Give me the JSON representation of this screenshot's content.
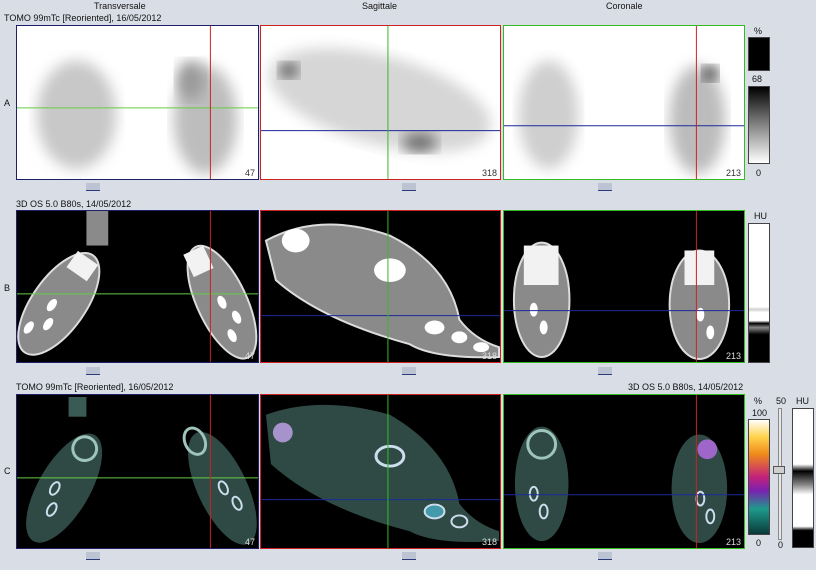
{
  "columns": {
    "transversale": "Transversale",
    "sagittale": "Sagittale",
    "coronale": "Coronale"
  },
  "rows": {
    "a": {
      "label": "A",
      "series": "TOMO 99mTc [Reoriented], 16/05/2012"
    },
    "b": {
      "label": "B",
      "series": "3D  OS  5.0  B80s, 14/05/2012"
    },
    "c": {
      "label": "C",
      "series_left": "TOMO 99mTc [Reoriented], 16/05/2012",
      "series_right": "3D  OS  5.0  B80s, 14/05/2012"
    }
  },
  "slices": {
    "trans": "47",
    "sag": "318",
    "cor": "213"
  },
  "scales": {
    "a": {
      "unit": "%",
      "val": "68",
      "min": "0"
    },
    "b": {
      "unit": "HU"
    },
    "c": {
      "unit1": "%",
      "max1": "100",
      "min1": "0",
      "mid": "50",
      "min2": "0",
      "unit2": "HU"
    }
  },
  "colors": {
    "red": "#cc2222",
    "green": "#33bb22",
    "blue": "#1a2a9a",
    "navy": "#20206a"
  }
}
